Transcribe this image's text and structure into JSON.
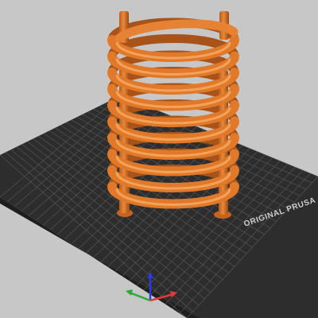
{
  "viewport": {
    "background_color": "#c7c7c7",
    "bed_label": "ORIGINAL PRUSA",
    "bed_color": "#2d2d2d",
    "grid_color": "#5a5a5a",
    "model_color": "#e07a2a",
    "model_shadow_color": "#a8531a",
    "axes": {
      "x_color": "#e03a3a",
      "y_color": "#2aa83a",
      "z_color": "#2a3ae0"
    },
    "objects": [
      "helical-coil-model"
    ]
  }
}
